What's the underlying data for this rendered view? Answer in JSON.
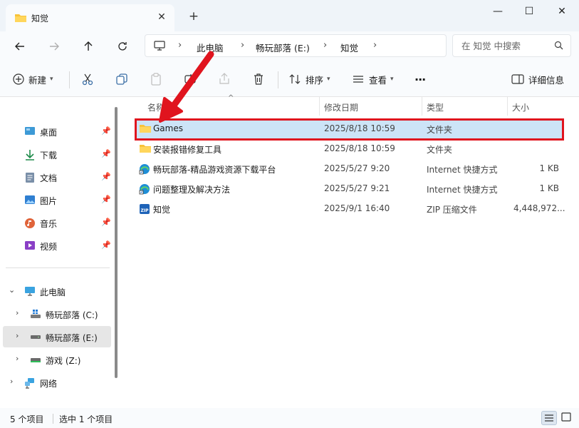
{
  "window": {
    "tab_title": "知觉",
    "new_tab_symbol": "+",
    "close_tab_symbol": "✕",
    "minimize_symbol": "—",
    "maximize_symbol": "☐",
    "close_symbol": "✕"
  },
  "breadcrumb": {
    "items": [
      "此电脑",
      "畅玩部落 (E:)",
      "知觉"
    ]
  },
  "search": {
    "placeholder": "在 知觉 中搜索"
  },
  "toolbar": {
    "new_label": "新建",
    "sort_label": "排序",
    "view_label": "查看",
    "more_label": "···",
    "details_label": "详细信息"
  },
  "sidebar": {
    "quick_access": [
      {
        "label": "桌面",
        "icon": "desktop-icon"
      },
      {
        "label": "下载",
        "icon": "download-icon"
      },
      {
        "label": "文档",
        "icon": "documents-icon"
      },
      {
        "label": "图片",
        "icon": "pictures-icon"
      },
      {
        "label": "音乐",
        "icon": "music-icon"
      },
      {
        "label": "视频",
        "icon": "videos-icon"
      }
    ],
    "this_pc": "此电脑",
    "drives": [
      {
        "label": "畅玩部落 (C:)"
      },
      {
        "label": "畅玩部落 (E:)"
      },
      {
        "label": "游戏 (Z:)"
      }
    ],
    "network": "网络"
  },
  "columns": {
    "name": "名称",
    "date": "修改日期",
    "type": "类型",
    "size": "大小"
  },
  "files": [
    {
      "name": "Games",
      "date": "2025/8/18 10:59",
      "type": "文件夹",
      "size": "",
      "icon": "folder-icon",
      "selected": true
    },
    {
      "name": "安装报错修复工具",
      "date": "2025/8/18 10:59",
      "type": "文件夹",
      "size": "",
      "icon": "folder-icon",
      "selected": false
    },
    {
      "name": "畅玩部落-精品游戏资源下载平台",
      "date": "2025/5/27 9:20",
      "type": "Internet 快捷方式",
      "size": "1 KB",
      "icon": "internet-shortcut-icon",
      "selected": false
    },
    {
      "name": "问题整理及解决方法",
      "date": "2025/5/27 9:21",
      "type": "Internet 快捷方式",
      "size": "1 KB",
      "icon": "internet-shortcut-icon",
      "selected": false
    },
    {
      "name": "知觉",
      "date": "2025/9/1 16:40",
      "type": "ZIP 压缩文件",
      "size": "4,448,972...",
      "icon": "zip-icon",
      "selected": false
    }
  ],
  "status": {
    "item_count": "5 个项目",
    "selected_count": "选中 1 个项目"
  },
  "colors": {
    "accent": "#0067c0",
    "selection": "#cce4f7",
    "highlight_border": "#e0141e",
    "arrow": "#e0141e"
  }
}
